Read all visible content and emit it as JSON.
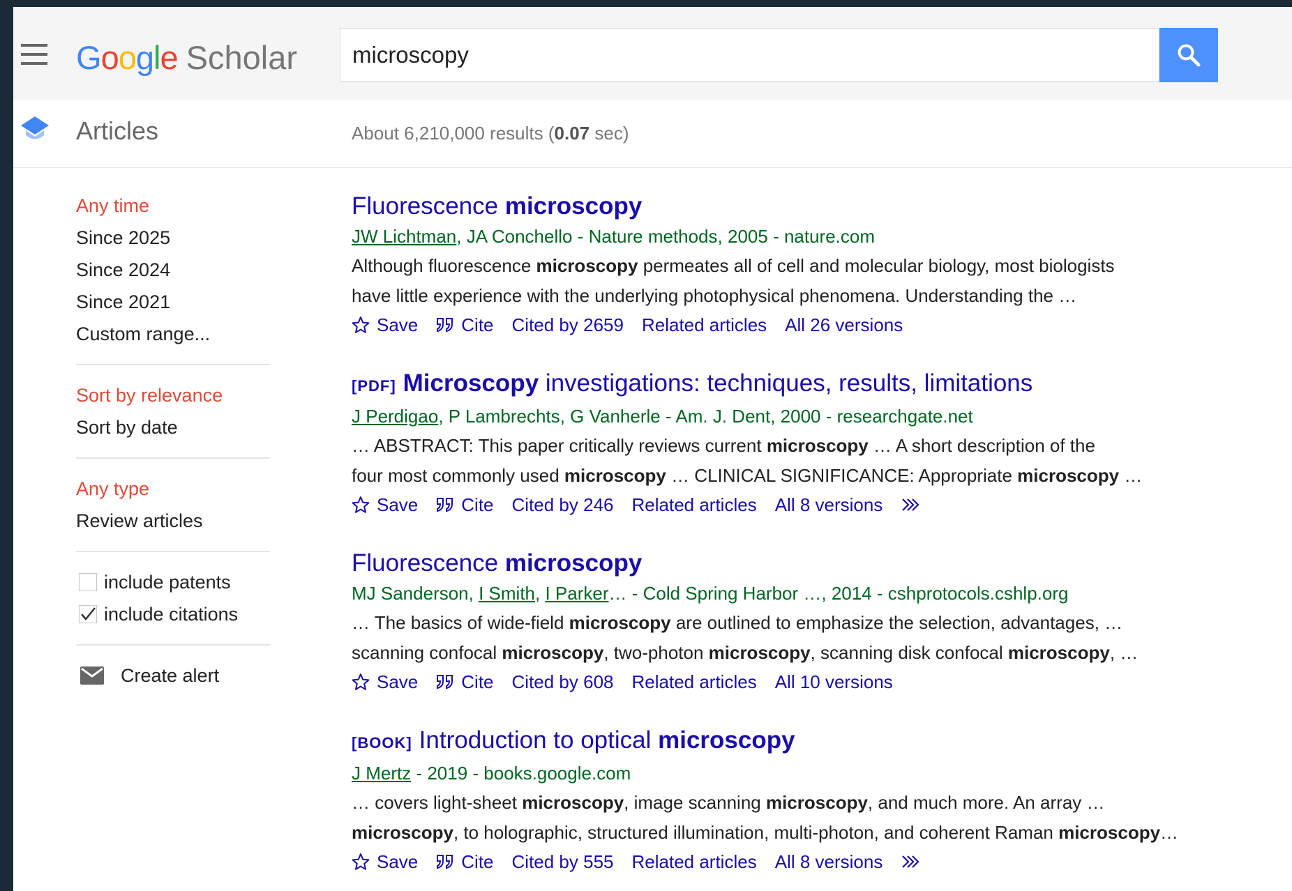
{
  "header": {
    "logo_letters": [
      {
        "ch": "G",
        "color": "#4285f4"
      },
      {
        "ch": "o",
        "color": "#ea4335"
      },
      {
        "ch": "o",
        "color": "#fbbc05"
      },
      {
        "ch": "g",
        "color": "#4285f4"
      },
      {
        "ch": "l",
        "color": "#34a853"
      },
      {
        "ch": "e",
        "color": "#ea4335"
      }
    ],
    "logo_product": "Scholar",
    "search_value": "microscopy",
    "search_button_icon": "search-icon"
  },
  "subbar": {
    "section_label": "Articles",
    "stats_prefix": "About 6,210,000 results (",
    "stats_time": "0.07",
    "stats_suffix": " sec)"
  },
  "sidebar": {
    "time_filters": [
      {
        "label": "Any time",
        "active": true
      },
      {
        "label": "Since 2025",
        "active": false
      },
      {
        "label": "Since 2024",
        "active": false
      },
      {
        "label": "Since 2021",
        "active": false
      },
      {
        "label": "Custom range...",
        "active": false
      }
    ],
    "sort_options": [
      {
        "label": "Sort by relevance",
        "active": true
      },
      {
        "label": "Sort by date",
        "active": false
      }
    ],
    "type_filters": [
      {
        "label": "Any type",
        "active": true
      },
      {
        "label": "Review articles",
        "active": false
      }
    ],
    "checkboxes": [
      {
        "label": "include patents",
        "checked": false
      },
      {
        "label": "include citations",
        "checked": true
      }
    ],
    "alert_label": "Create alert",
    "alert_icon": "envelope-icon"
  },
  "results": [
    {
      "prefix": "",
      "title": [
        {
          "t": "Fluorescence ",
          "b": false
        },
        {
          "t": "microscopy",
          "b": true
        }
      ],
      "authors": [
        {
          "t": "JW Lichtman",
          "link": true
        },
        {
          "t": ", JA Conchello - Nature methods, 2005 - nature.com",
          "link": false
        }
      ],
      "snippet": [
        [
          {
            "t": "Although fluorescence ",
            "b": false
          },
          {
            "t": "microscopy",
            "b": true
          },
          {
            "t": " permeates all of cell and molecular biology, most biologists",
            "b": false
          }
        ],
        [
          {
            "t": "have little experience with the underlying photophysical phenomena. Understanding the …",
            "b": false
          }
        ]
      ],
      "save": "Save",
      "cite": "Cite",
      "cited_by": "Cited by 2659",
      "related": "Related articles",
      "versions": "All 26 versions",
      "more": false
    },
    {
      "prefix": "[PDF]",
      "title": [
        {
          "t": "Microscopy",
          "b": true
        },
        {
          "t": " investigations: techniques, results, limitations",
          "b": false
        }
      ],
      "authors": [
        {
          "t": "J Perdigao",
          "link": true
        },
        {
          "t": ", P Lambrechts, G Vanherle - Am. J. Dent, 2000 - researchgate.net",
          "link": false
        }
      ],
      "snippet": [
        [
          {
            "t": "… ABSTRACT: This paper critically reviews current ",
            "b": false
          },
          {
            "t": "microscopy",
            "b": true
          },
          {
            "t": " … A short description of the",
            "b": false
          }
        ],
        [
          {
            "t": "four most commonly used ",
            "b": false
          },
          {
            "t": "microscopy",
            "b": true
          },
          {
            "t": " … CLINICAL SIGNIFICANCE: Appropriate ",
            "b": false
          },
          {
            "t": "microscopy",
            "b": true
          },
          {
            "t": " …",
            "b": false
          }
        ]
      ],
      "save": "Save",
      "cite": "Cite",
      "cited_by": "Cited by 246",
      "related": "Related articles",
      "versions": "All 8 versions",
      "more": true
    },
    {
      "prefix": "",
      "title": [
        {
          "t": "Fluorescence ",
          "b": false
        },
        {
          "t": "microscopy",
          "b": true
        }
      ],
      "authors": [
        {
          "t": "MJ Sanderson, ",
          "link": false
        },
        {
          "t": "I Smith",
          "link": true
        },
        {
          "t": ", ",
          "link": false
        },
        {
          "t": "I Parker",
          "link": true
        },
        {
          "t": "… - Cold Spring Harbor …, 2014 - cshprotocols.cshlp.org",
          "link": false
        }
      ],
      "snippet": [
        [
          {
            "t": "… The basics of wide-field ",
            "b": false
          },
          {
            "t": "microscopy",
            "b": true
          },
          {
            "t": " are outlined to emphasize the selection, advantages, …",
            "b": false
          }
        ],
        [
          {
            "t": "scanning confocal ",
            "b": false
          },
          {
            "t": "microscopy",
            "b": true
          },
          {
            "t": ", two-photon ",
            "b": false
          },
          {
            "t": "microscopy",
            "b": true
          },
          {
            "t": ", scanning disk confocal ",
            "b": false
          },
          {
            "t": "microscopy",
            "b": true
          },
          {
            "t": ", …",
            "b": false
          }
        ]
      ],
      "save": "Save",
      "cite": "Cite",
      "cited_by": "Cited by 608",
      "related": "Related articles",
      "versions": "All 10 versions",
      "more": false
    },
    {
      "prefix": "[BOOK]",
      "title": [
        {
          "t": "Introduction to optical ",
          "b": false
        },
        {
          "t": "microscopy",
          "b": true
        }
      ],
      "authors": [
        {
          "t": "J Mertz",
          "link": true
        },
        {
          "t": " - 2019 - books.google.com",
          "link": false
        }
      ],
      "snippet": [
        [
          {
            "t": "… covers light-sheet ",
            "b": false
          },
          {
            "t": "microscopy",
            "b": true
          },
          {
            "t": ", image scanning ",
            "b": false
          },
          {
            "t": "microscopy",
            "b": true
          },
          {
            "t": ", and much more. An array …",
            "b": false
          }
        ],
        [
          {
            "t": "microscopy",
            "b": true
          },
          {
            "t": ", to holographic, structured illumination, multi-photon, and coherent Raman ",
            "b": false
          },
          {
            "t": "microscopy",
            "b": true
          },
          {
            "t": "…",
            "b": false
          }
        ]
      ],
      "save": "Save",
      "cite": "Cite",
      "cited_by": "Cited by 555",
      "related": "Related articles",
      "versions": "All 8 versions",
      "more": true
    }
  ],
  "colors": {
    "accent_blue": "#4d90fe",
    "link_blue": "#1a0dab",
    "author_green": "#006621",
    "active_red": "#dd4b39"
  }
}
